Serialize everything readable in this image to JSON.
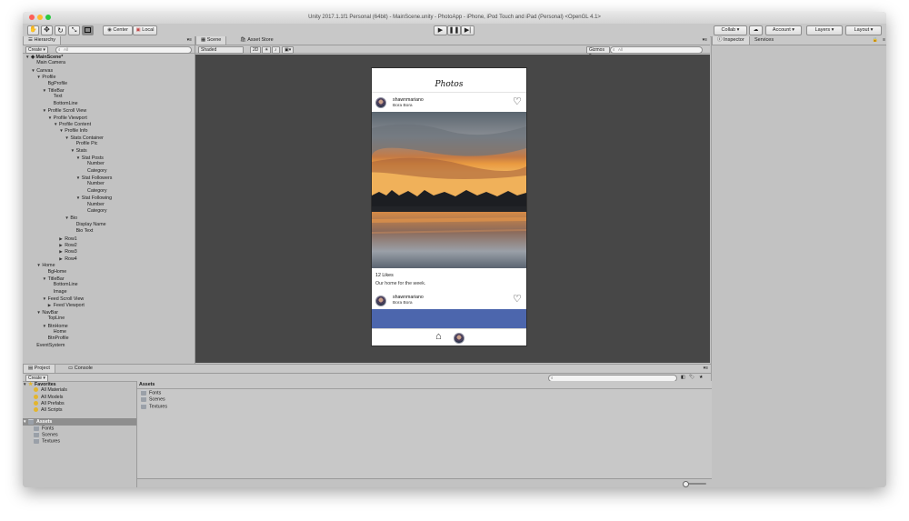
{
  "window": {
    "title": "Unity 2017.1.1f1 Personal (64bit) - MainScene.unity - PhotoApp - iPhone, iPod Touch and iPad (Personal) <OpenGL 4.1>"
  },
  "colors": {
    "scene_bg": "#474747",
    "accent_blue": "#4c66ad",
    "selection": "#8e8e8e",
    "traffic_red": "#fd5f57",
    "traffic_yellow": "#febb2e",
    "traffic_green": "#2ac941"
  },
  "toolbar": {
    "tools": [
      "hand-icon",
      "move-icon",
      "rotate-icon",
      "scale-icon",
      "rect-icon"
    ],
    "pivot_label": "Center",
    "space_label": "Local",
    "play": [
      "play-icon",
      "pause-icon",
      "step-icon"
    ],
    "collab_label": "Collab ▾",
    "cloud_icon": "cloud-icon",
    "account_label": "Account ▾",
    "layers_label": "Layers ▾",
    "layout_label": "Layout ▾"
  },
  "hierarchy": {
    "tab_label": "Hierarchy",
    "create_label": "Create ▾",
    "search_placeholder": "All",
    "items": [
      {
        "label": "MainScene*",
        "depth": 0,
        "arrow": "open",
        "selected": true
      },
      {
        "label": "Main Camera",
        "depth": 1,
        "arrow": "none"
      },
      {
        "label": "Canvas",
        "depth": 1,
        "arrow": "open"
      },
      {
        "label": "Profile",
        "depth": 2,
        "arrow": "open"
      },
      {
        "label": "BgProfile",
        "depth": 3,
        "arrow": "none"
      },
      {
        "label": "TitleBar",
        "depth": 3,
        "arrow": "open"
      },
      {
        "label": "Text",
        "depth": 4,
        "arrow": "none"
      },
      {
        "label": "BottomLine",
        "depth": 4,
        "arrow": "none"
      },
      {
        "label": "Profile Scroll View",
        "depth": 3,
        "arrow": "open"
      },
      {
        "label": "Profile Viewport",
        "depth": 4,
        "arrow": "open"
      },
      {
        "label": "Profile Content",
        "depth": 5,
        "arrow": "open"
      },
      {
        "label": "Profile Info",
        "depth": 6,
        "arrow": "open"
      },
      {
        "label": "Stats Container",
        "depth": 7,
        "arrow": "open"
      },
      {
        "label": "Profile Pic",
        "depth": 8,
        "arrow": "none"
      },
      {
        "label": "Stats",
        "depth": 8,
        "arrow": "open"
      },
      {
        "label": "Stat Posts",
        "depth": 9,
        "arrow": "open"
      },
      {
        "label": "Number",
        "depth": 10,
        "arrow": "none"
      },
      {
        "label": "Category",
        "depth": 10,
        "arrow": "none"
      },
      {
        "label": "Stat Followers",
        "depth": 9,
        "arrow": "open"
      },
      {
        "label": "Number",
        "depth": 10,
        "arrow": "none"
      },
      {
        "label": "Category",
        "depth": 10,
        "arrow": "none"
      },
      {
        "label": "Stat Following",
        "depth": 9,
        "arrow": "open"
      },
      {
        "label": "Number",
        "depth": 10,
        "arrow": "none"
      },
      {
        "label": "Category",
        "depth": 10,
        "arrow": "none"
      },
      {
        "label": "Bio",
        "depth": 7,
        "arrow": "open"
      },
      {
        "label": "Display Name",
        "depth": 8,
        "arrow": "none"
      },
      {
        "label": "Bio Text",
        "depth": 8,
        "arrow": "none"
      },
      {
        "label": "Row1",
        "depth": 6,
        "arrow": "closed"
      },
      {
        "label": "Row2",
        "depth": 6,
        "arrow": "closed"
      },
      {
        "label": "Row3",
        "depth": 6,
        "arrow": "closed"
      },
      {
        "label": "Row4",
        "depth": 6,
        "arrow": "closed"
      },
      {
        "label": "Home",
        "depth": 2,
        "arrow": "open"
      },
      {
        "label": "BgHome",
        "depth": 3,
        "arrow": "none"
      },
      {
        "label": "TitleBar",
        "depth": 3,
        "arrow": "open"
      },
      {
        "label": "BottomLine",
        "depth": 4,
        "arrow": "none"
      },
      {
        "label": "Image",
        "depth": 4,
        "arrow": "none"
      },
      {
        "label": "Feed Scroll View",
        "depth": 3,
        "arrow": "open"
      },
      {
        "label": "Feed Viewport",
        "depth": 4,
        "arrow": "closed"
      },
      {
        "label": "NavBar",
        "depth": 2,
        "arrow": "open"
      },
      {
        "label": "TopLine",
        "depth": 3,
        "arrow": "none"
      },
      {
        "label": "BtnHome",
        "depth": 3,
        "arrow": "open"
      },
      {
        "label": "Home",
        "depth": 4,
        "arrow": "none"
      },
      {
        "label": "BtnProfile",
        "depth": 3,
        "arrow": "none"
      },
      {
        "label": "EventSystem",
        "depth": 1,
        "arrow": "none"
      }
    ]
  },
  "scene": {
    "tab_scene": "Scene",
    "tab_asset_store": "Asset Store",
    "shading_label": "Shaded",
    "mode_2d_label": "2D",
    "gizmos_label": "Gizmos ▾",
    "search_placeholder": "All"
  },
  "phone": {
    "header_title": "Photos",
    "post1": {
      "username": "shawnmariano",
      "location": "Bora Bora"
    },
    "likes": "12 Likes",
    "caption": "Our home for the week.",
    "post2": {
      "username": "shawnmariano",
      "location": "Bora Bora"
    },
    "nav_home_icon": "home-icon",
    "nav_profile_icon": "profile-avatar-icon"
  },
  "inspector": {
    "tab_inspector": "Inspector",
    "tab_services": "Services"
  },
  "project": {
    "tab_project": "Project",
    "tab_console": "Console",
    "create_label": "Create ▾",
    "favorites_label": "Favorites",
    "favorites": [
      "All Materials",
      "All Models",
      "All Prefabs",
      "All Scripts"
    ],
    "assets_label": "Assets",
    "asset_folders": [
      "Fonts",
      "Scenes",
      "Textures"
    ],
    "breadcrumb": "Assets",
    "grid_items": [
      "Fonts",
      "Scenes",
      "Textures"
    ]
  }
}
